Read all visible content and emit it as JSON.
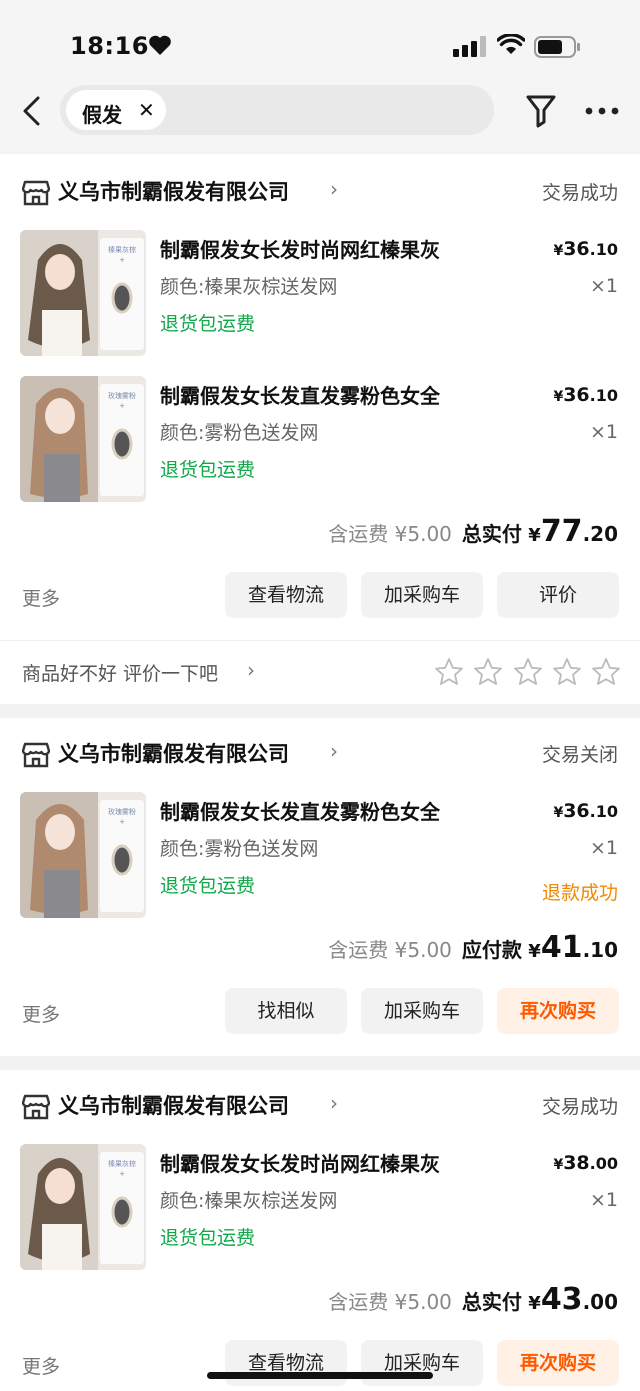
{
  "status_bar": {
    "time": "18:16"
  },
  "search": {
    "keyword": "假发"
  },
  "orders": [
    {
      "shop": "义乌市制霸假发有限公司",
      "status": "交易成功",
      "items": [
        {
          "title": "制霸假发女长发时尚网红榛果灰",
          "sku": "颜色:榛果灰棕送发网",
          "service": "退货包运费",
          "price_yuan": "36",
          "price_cents": ".10",
          "qty": "×1",
          "thumb_label": "榛果灰棕",
          "hair_color": "#6b5a4a"
        },
        {
          "title": "制霸假发女长发直发雾粉色女全",
          "sku": "颜色:雾粉色送发网",
          "service": "退货包运费",
          "price_yuan": "36",
          "price_cents": ".10",
          "qty": "×1",
          "thumb_label": "玫瑰雾粉",
          "hair_color": "#b08a6e"
        }
      ],
      "shipping": "含运费 ¥5.00",
      "total_label": "总实付",
      "total_int": "77",
      "total_cents": ".20",
      "more": "更多",
      "buttons": [
        "查看物流",
        "加采购车",
        "评价"
      ],
      "rate_prompt": "商品好不好 评价一下吧"
    },
    {
      "shop": "义乌市制霸假发有限公司",
      "status": "交易关闭",
      "items": [
        {
          "title": "制霸假发女长发直发雾粉色女全",
          "sku": "颜色:雾粉色送发网",
          "service": "退货包运费",
          "price_yuan": "36",
          "price_cents": ".10",
          "qty": "×1",
          "refund": "退款成功",
          "thumb_label": "玫瑰雾粉",
          "hair_color": "#b08a6e"
        }
      ],
      "shipping": "含运费 ¥5.00",
      "total_label": "应付款",
      "total_int": "41",
      "total_cents": ".10",
      "more": "更多",
      "buttons": [
        "找相似",
        "加采购车",
        "再次购买"
      ]
    },
    {
      "shop": "义乌市制霸假发有限公司",
      "status": "交易成功",
      "items": [
        {
          "title": "制霸假发女长发时尚网红榛果灰",
          "sku": "颜色:榛果灰棕送发网",
          "service": "退货包运费",
          "price_yuan": "38",
          "price_cents": ".00",
          "qty": "×1",
          "thumb_label": "榛果灰棕",
          "hair_color": "#6b5a4a"
        }
      ],
      "shipping": "含运费 ¥5.00",
      "total_label": "总实付",
      "total_int": "43",
      "total_cents": ".00",
      "more": "更多",
      "buttons": [
        "查看物流",
        "加采购车",
        "再次购买"
      ]
    }
  ],
  "colors": {
    "accent": "#ff5a00",
    "service_green": "#12a84a",
    "refund_orange": "#f08a00"
  }
}
